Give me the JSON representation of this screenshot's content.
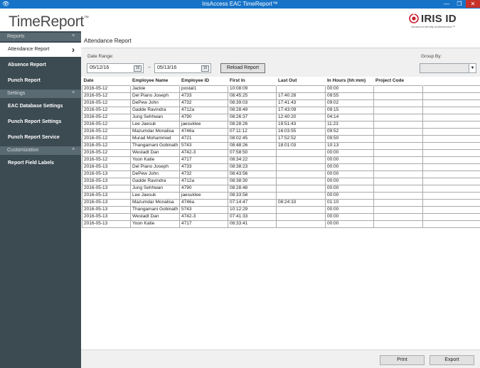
{
  "window": {
    "title": "IrisAccess EAC TimeReport™",
    "icon": "eye-icon",
    "controls": {
      "minimize": "—",
      "maximize": "❐",
      "close": "✕"
    }
  },
  "header": {
    "app_logo": "TimeReport",
    "app_logo_tm": "™",
    "brand": "IRIS ID",
    "brand_tagline": "Advanced Identity Authentication™"
  },
  "sidebar": {
    "sections": [
      {
        "label": "Reports",
        "items": [
          "Attendance Report",
          "Absence Report",
          "Punch Report"
        ]
      },
      {
        "label": "Settings",
        "items": [
          "EAC Database Settings",
          "Punch Report Settings",
          "Punch Report Service"
        ]
      },
      {
        "label": "Customization",
        "items": [
          "Report Field Labels"
        ]
      }
    ],
    "active_item": "Attendance Report"
  },
  "main": {
    "page_title": "Attendance Report",
    "filters": {
      "date_range_label": "Date Range:",
      "start_date": "05/12/16",
      "end_date": "05/13/16",
      "separator": "~",
      "calendar_glyph": "15",
      "reload_label": "Reload Report",
      "group_by_label": "Group By:",
      "group_by_value": ""
    },
    "table": {
      "columns": [
        "Date",
        "Employee Name",
        "Employee ID",
        "First In",
        "Last Out",
        "In Hours (hh:mm)",
        "Project Code",
        ""
      ],
      "rows": [
        [
          "2016-05-12",
          "Jackie",
          "postal1",
          "10:08:09",
          "",
          "00:00",
          "",
          ""
        ],
        [
          "2016-05-12",
          "Del Piano Joseph",
          "4733",
          "08:45:25",
          "17:40:28",
          "09:55",
          "",
          ""
        ],
        [
          "2016-05-12",
          "DePew John",
          "4732",
          "08:39:03",
          "17:41:43",
          "09:02",
          "",
          ""
        ],
        [
          "2016-05-12",
          "Gadde Ravindra",
          "4712a",
          "08:28:49",
          "17:43:09",
          "09:15",
          "",
          ""
        ],
        [
          "2016-05-12",
          "Jung Sehhwan",
          "4790",
          "08:26:37",
          "12:40:20",
          "04:14",
          "",
          ""
        ],
        [
          "2016-05-12",
          "Lee Jaesuk",
          "jaesuklee",
          "08:28:26",
          "19:51:43",
          "11:23",
          "",
          ""
        ],
        [
          "2016-05-12",
          "Mazumdar Monalisa",
          "4746a",
          "07:11:12",
          "16:03:55",
          "09:52",
          "",
          ""
        ],
        [
          "2016-05-12",
          "Murad Mohammed",
          "4721",
          "08:02:45",
          "17:52:52",
          "09:50",
          "",
          ""
        ],
        [
          "2016-05-12",
          "Thangamani Gobinath",
          "5743",
          "08:48:26",
          "18:01:03",
          "10:13",
          "",
          ""
        ],
        [
          "2016-05-12",
          "Westadt Dan",
          "4742-3",
          "07:58:50",
          "",
          "00:00",
          "",
          ""
        ],
        [
          "2016-05-12",
          "Yoon Katie",
          "4717",
          "08:34:22",
          "",
          "00:00",
          "",
          ""
        ],
        [
          "2016-05-13",
          "Del Piano Joseph",
          "4733",
          "08:38:23",
          "",
          "00:00",
          "",
          ""
        ],
        [
          "2016-05-13",
          "DePew John",
          "4732",
          "08:43:56",
          "",
          "00:00",
          "",
          ""
        ],
        [
          "2016-05-13",
          "Gadde Ravindra",
          "4712a",
          "08:38:30",
          "",
          "00:00",
          "",
          ""
        ],
        [
          "2016-05-13",
          "Jung Sehhwan",
          "4790",
          "08:28:48",
          "",
          "00:00",
          "",
          ""
        ],
        [
          "2016-05-13",
          "Lee Jaesuk",
          "jaesuklee",
          "08:33:58",
          "",
          "00:00",
          "",
          ""
        ],
        [
          "2016-05-13",
          "Mazumdar Monalisa",
          "4746a",
          "07:14:47",
          "08:24:33",
          "01:10",
          "",
          ""
        ],
        [
          "2016-05-13",
          "Thangamani Gobinath",
          "5743",
          "10:12:29",
          "",
          "00:00",
          "",
          ""
        ],
        [
          "2016-05-13",
          "Westadt Dan",
          "4742-3",
          "07:41:33",
          "",
          "00:00",
          "",
          ""
        ],
        [
          "2016-05-13",
          "Yoon Katie",
          "4717",
          "08:33:41",
          "",
          "00:00",
          "",
          ""
        ]
      ]
    },
    "footer": {
      "print_label": "Print",
      "export_label": "Export"
    }
  },
  "colors": {
    "titlebar": "#1673c8",
    "sidebar": "#3c4a52",
    "sidebar_section": "#5a6a72",
    "close": "#c7312a",
    "brand_red": "#c8202f"
  }
}
